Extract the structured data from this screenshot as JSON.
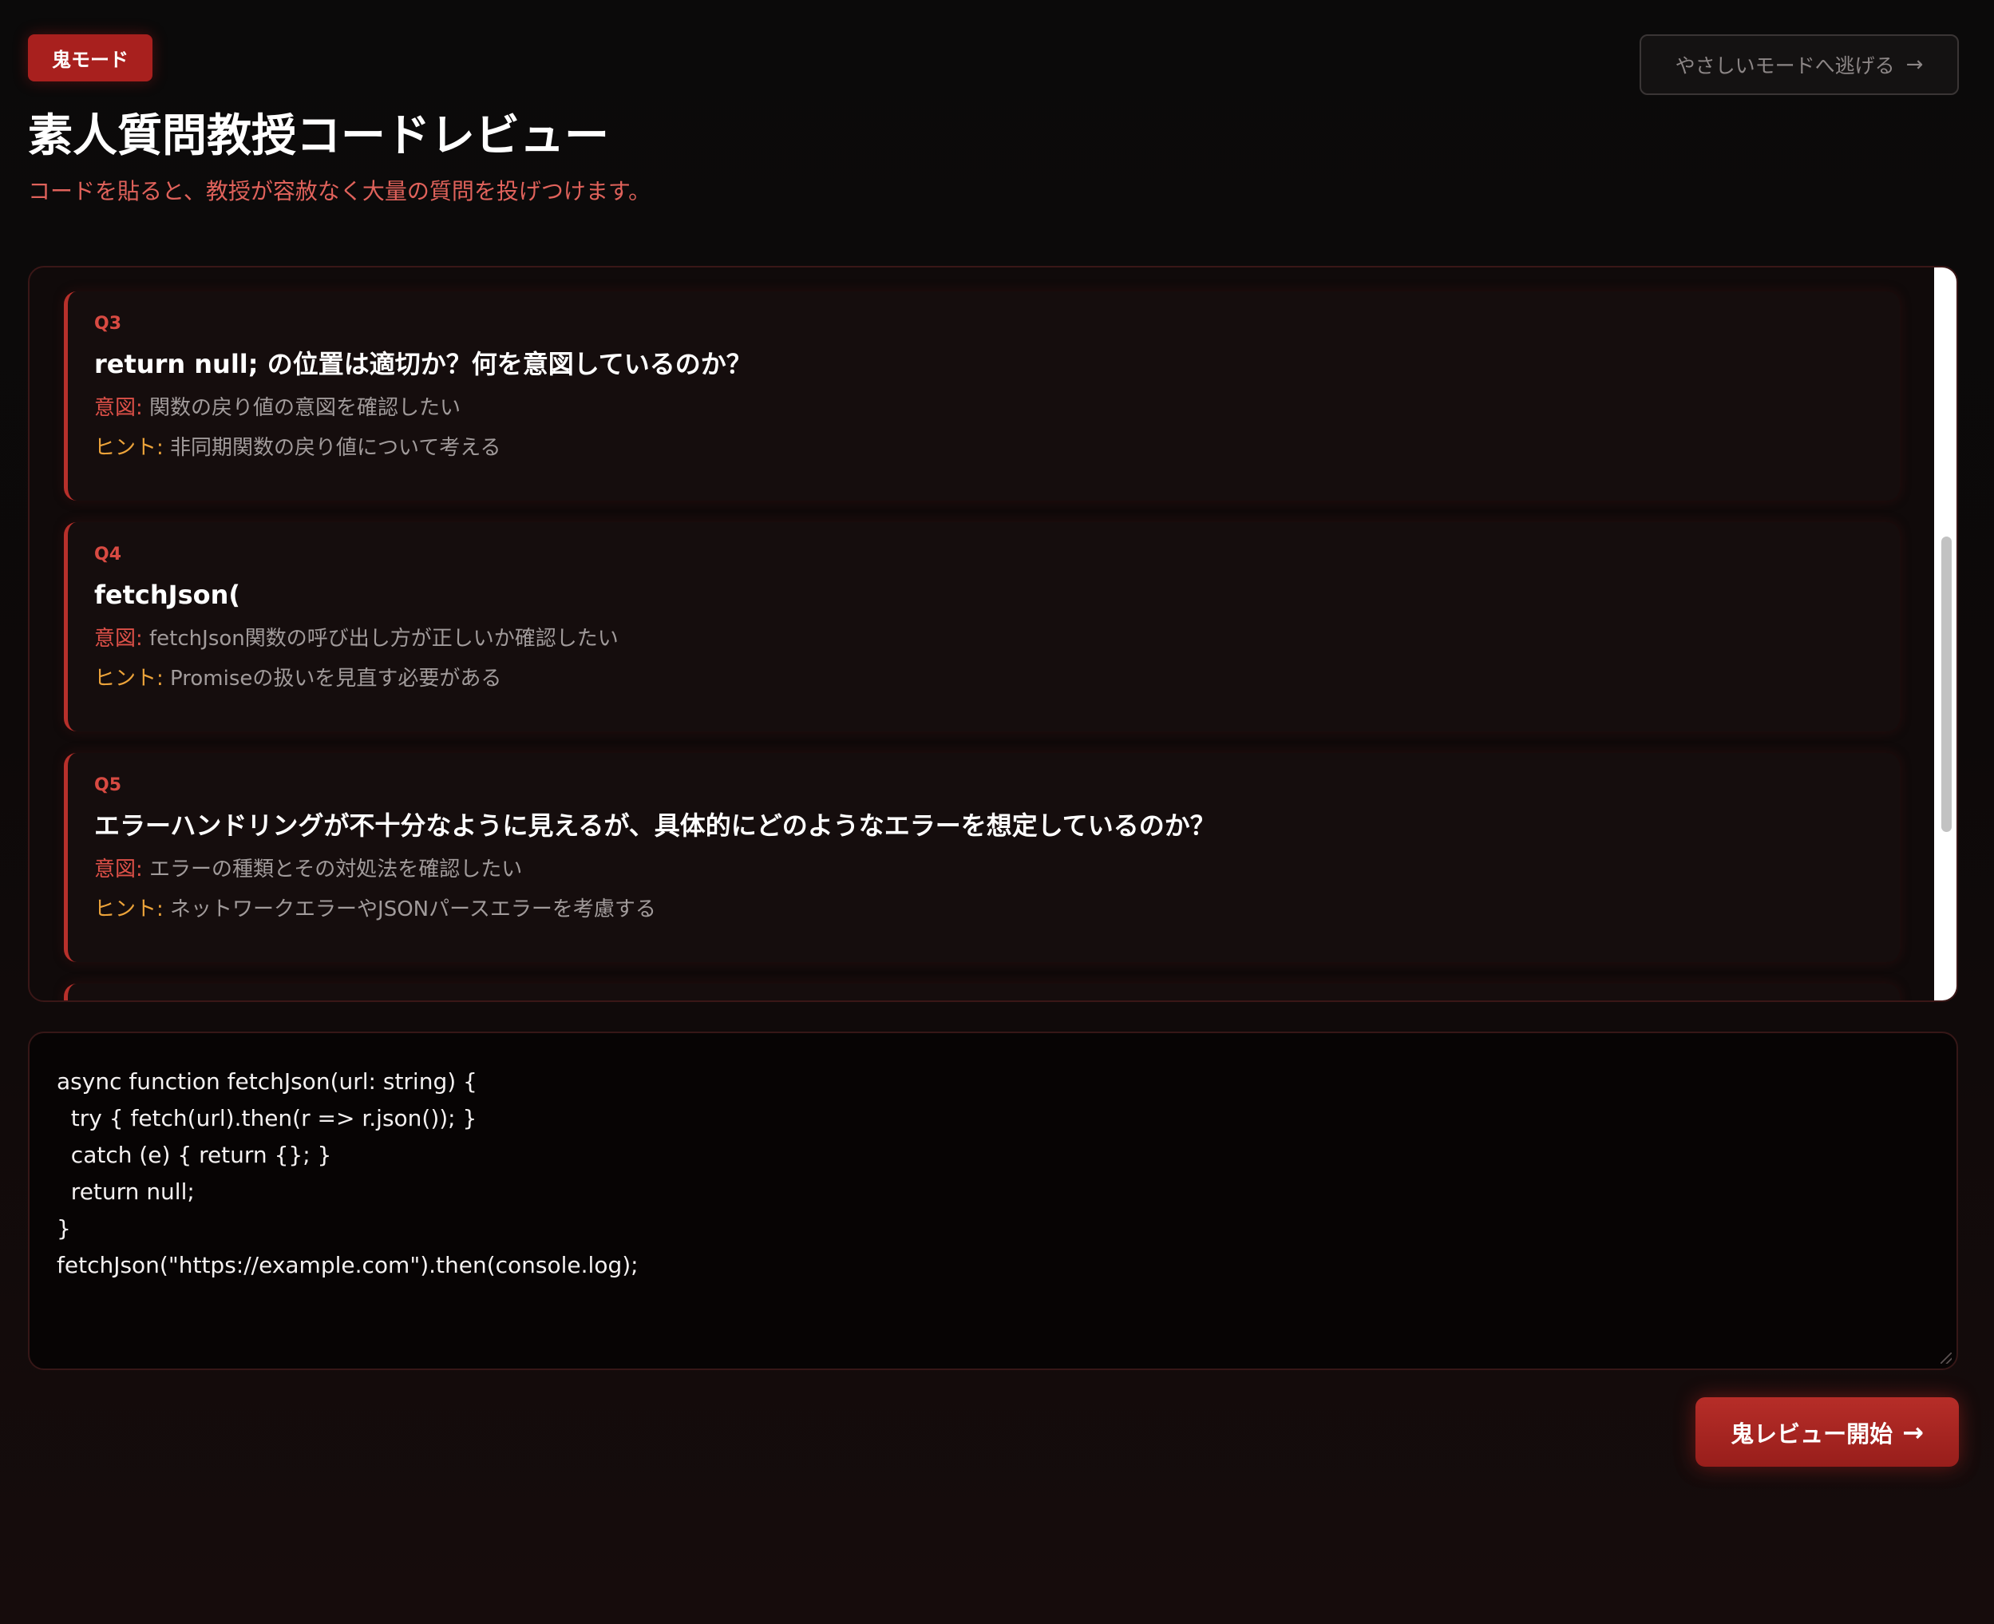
{
  "header": {
    "mode_badge": "鬼モード",
    "escape_button": "やさしいモードへ逃げる",
    "escape_arrow": "→",
    "title": "素人質問教授コードレビュー",
    "subtitle": "コードを貼ると、教授が容赦なく大量の質問を投げつけます。"
  },
  "labels": {
    "intent": "意図:",
    "hint": "ヒント:"
  },
  "questions": [
    {
      "num": "Q3",
      "text": "return null; の位置は適切か？何を意図しているのか？",
      "intent": "関数の戻り値の意図を確認したい",
      "hint": "非同期関数の戻り値について考える"
    },
    {
      "num": "Q4",
      "text": "fetchJson(",
      "intent": "fetchJson関数の呼び出し方が正しいか確認したい",
      "hint": "Promiseの扱いを見直す必要がある"
    },
    {
      "num": "Q5",
      "text": "エラーハンドリングが不十分なように見えるが、具体的にどのようなエラーを想定しているのか？",
      "intent": "エラーの種類とその対処法を確認したい",
      "hint": "ネットワークエラーやJSONパースエラーを考慮する"
    }
  ],
  "code": {
    "value": "async function fetchJson(url: string) {\n  try { fetch(url).then(r => r.json()); }\n  catch (e) { return {}; }\n  return null;\n}\nfetchJson(\"https://example.com\").then(console.log);"
  },
  "start_button": {
    "label": "鬼レビュー開始",
    "arrow": "→"
  },
  "colors": {
    "accent": "#a8201e",
    "intent_label": "#dd5048",
    "hint_label": "#eca33a"
  }
}
